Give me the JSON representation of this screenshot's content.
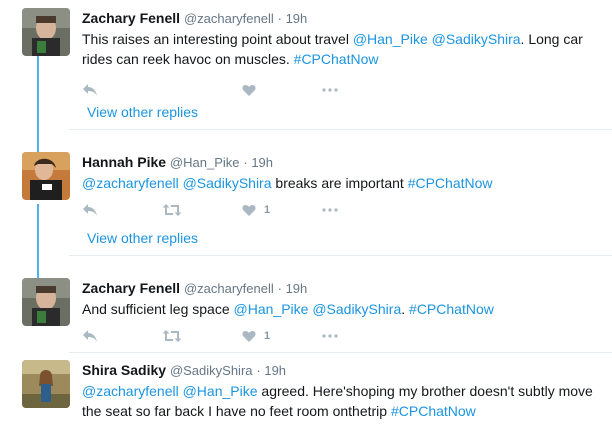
{
  "tweets": [
    {
      "name": "Zachary Fenell",
      "handle": "@zacharyfenell",
      "time": "· 19h",
      "body": [
        {
          "t": "text",
          "v": "This raises an interesting point about travel "
        },
        {
          "t": "link",
          "v": "@Han_Pike"
        },
        {
          "t": "text",
          "v": " "
        },
        {
          "t": "link",
          "v": "@SadikyShira"
        },
        {
          "t": "text",
          "v": ". Long car rides can reek havoc on muscles. "
        },
        {
          "t": "link",
          "v": "#CPChatNow"
        }
      ],
      "like_count": "",
      "view_replies": "View other replies"
    },
    {
      "name": "Hannah Pike",
      "handle": "@Han_Pike",
      "time": "· 19h",
      "body": [
        {
          "t": "link",
          "v": "@zacharyfenell"
        },
        {
          "t": "text",
          "v": " "
        },
        {
          "t": "link",
          "v": "@SadikyShira"
        },
        {
          "t": "text",
          "v": " breaks are important "
        },
        {
          "t": "link",
          "v": "#CPChatNow"
        }
      ],
      "like_count": "1",
      "view_replies": "View other replies"
    },
    {
      "name": "Zachary Fenell",
      "handle": "@zacharyfenell",
      "time": "· 19h",
      "body": [
        {
          "t": "text",
          "v": "And sufficient leg space "
        },
        {
          "t": "link",
          "v": "@Han_Pike"
        },
        {
          "t": "text",
          "v": " "
        },
        {
          "t": "link",
          "v": "@SadikyShira"
        },
        {
          "t": "text",
          "v": ". "
        },
        {
          "t": "link",
          "v": "#CPChatNow"
        }
      ],
      "like_count": "1",
      "view_replies": ""
    },
    {
      "name": "Shira Sadiky",
      "handle": "@SadikyShira",
      "time": "· 19h",
      "body": [
        {
          "t": "link",
          "v": "@zacharyfenell"
        },
        {
          "t": "text",
          "v": " "
        },
        {
          "t": "link",
          "v": "@Han_Pike"
        },
        {
          "t": "text",
          "v": " agreed.  Here'shoping my brother doesn't subtly move the seat so far back I have no feet room onthetrip "
        },
        {
          "t": "link",
          "v": "#CPChatNow"
        }
      ],
      "like_count": "",
      "view_replies": ""
    }
  ],
  "icons": {
    "reply": "reply-icon",
    "retweet": "retweet-icon",
    "like": "heart-icon",
    "more": "more-icon"
  },
  "colors": {
    "link": "#1b95e0",
    "thread_line": "#4ab3f4",
    "secondary": "#657786",
    "action_icon": "#aab8c2"
  }
}
